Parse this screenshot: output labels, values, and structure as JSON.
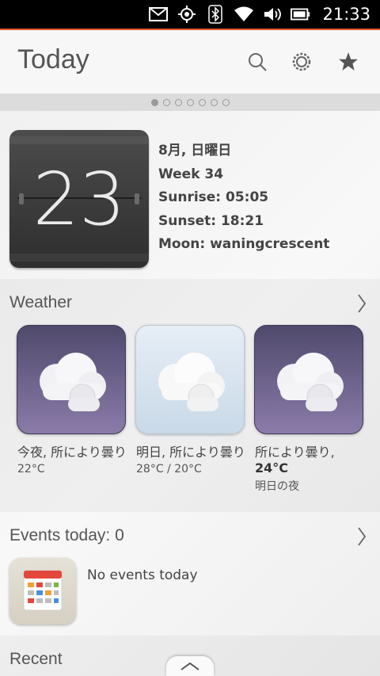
{
  "status_bar": {
    "time": "21:33",
    "icons": [
      "mail-icon",
      "location-icon",
      "bluetooth-icon",
      "wifi-icon",
      "volume-icon",
      "battery-icon"
    ]
  },
  "colors": {
    "accent": "#e4572e",
    "status_bg": "#000000"
  },
  "header": {
    "title": "Today",
    "actions": [
      "search-icon",
      "settings-icon",
      "favorite-icon"
    ]
  },
  "pages": {
    "count": 7,
    "active": 0
  },
  "date": {
    "day_number": "23",
    "month_weekday": "8月, 日曜日",
    "week": "Week 34",
    "sunrise": "Sunrise: 05:05",
    "sunset": "Sunset: 18:21",
    "moon": "Moon: waningcrescent"
  },
  "weather": {
    "title": "Weather",
    "cards": [
      {
        "desc": "今夜, 所により曇り",
        "temp": "22°C",
        "style": "night"
      },
      {
        "desc": "明日, 所により曇り",
        "temp": "28°C / 20°C",
        "style": "day"
      },
      {
        "desc": "所により曇り,",
        "temp": "24°C",
        "note": "明日の夜",
        "style": "night"
      }
    ]
  },
  "events": {
    "title": "Events today: 0",
    "empty_text": "No events today"
  },
  "recent": {
    "title": "Recent"
  }
}
